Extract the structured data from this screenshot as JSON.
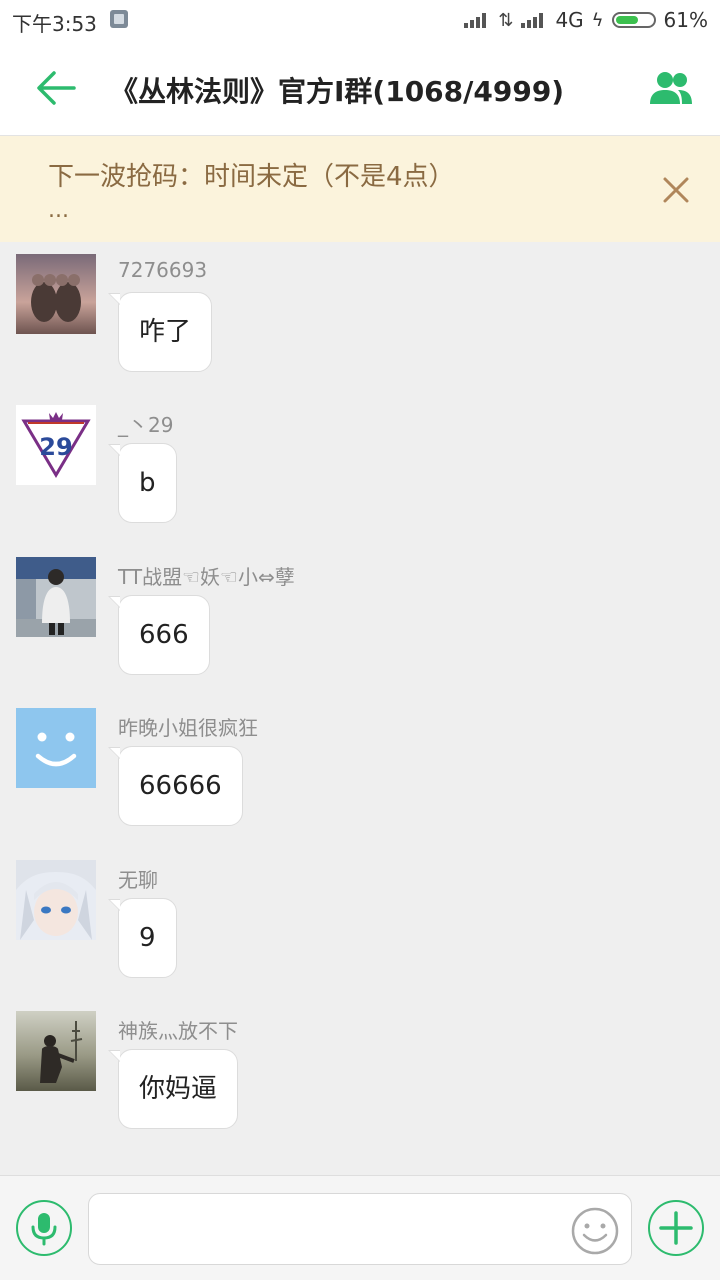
{
  "status_bar": {
    "time": "下午3:53",
    "network": "4G",
    "battery_percent": "61%",
    "battery_level": 0.61,
    "icons": [
      "notification-icon",
      "signal-icon",
      "data-transfer-icon",
      "signal-icon",
      "charging-icon",
      "battery-icon"
    ]
  },
  "header": {
    "title": "《丛林法则》官方I群(1068/4999)",
    "back_icon": "arrow-left-icon",
    "members_icon": "group-members-icon",
    "accent": "#2dbb6e"
  },
  "notice": {
    "text": "下一波抢码：时间未定（不是4点）",
    "more": "...",
    "close_icon": "close-icon"
  },
  "messages": [
    {
      "sender": "7276693",
      "text": "咋了"
    },
    {
      "sender": "_丶29",
      "text": "b"
    },
    {
      "sender": "TT战盟☜妖☜小⇔孽",
      "text": "666"
    },
    {
      "sender": "昨晚小姐很疯狂",
      "text": "66666"
    },
    {
      "sender": "无聊",
      "text": "9"
    },
    {
      "sender": "神族灬放不下",
      "text": "你妈逼"
    }
  ],
  "input_bar": {
    "value": "",
    "voice_icon": "microphone-icon",
    "emoji_icon": "emoji-icon",
    "plus_icon": "plus-icon"
  },
  "colors": {
    "accent_green": "#2dbb6e",
    "notice_bg": "#fbf3dc",
    "notice_text": "#8a6a42",
    "chat_bg": "#efefef"
  }
}
